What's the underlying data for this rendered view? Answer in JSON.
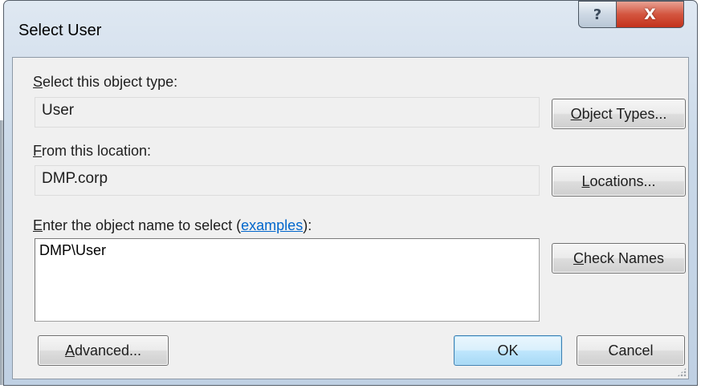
{
  "window": {
    "title": "Select User",
    "help_glyph": "?",
    "close_glyph": "X"
  },
  "object_type": {
    "label_accel": "S",
    "label_rest": "elect this object type:",
    "value": "User",
    "button_accel": "O",
    "button_rest": "bject Types..."
  },
  "location": {
    "label_accel": "F",
    "label_rest": "rom this location:",
    "value": "DMP.corp",
    "button_accel": "L",
    "button_rest": "ocations..."
  },
  "object_name": {
    "label_accel": "E",
    "label_rest": "nter the object name to select (",
    "link_text": "examples",
    "label_end": "):",
    "value": "DMP\\User",
    "check_button_accel": "C",
    "check_button_rest": "heck Names"
  },
  "footer": {
    "advanced_accel": "A",
    "advanced_rest": "dvanced...",
    "ok_label": "OK",
    "cancel_label": "Cancel"
  },
  "colors": {
    "default_button_border": "#3c7fb1",
    "link": "#0066cc",
    "close_button": "#c4331c"
  }
}
